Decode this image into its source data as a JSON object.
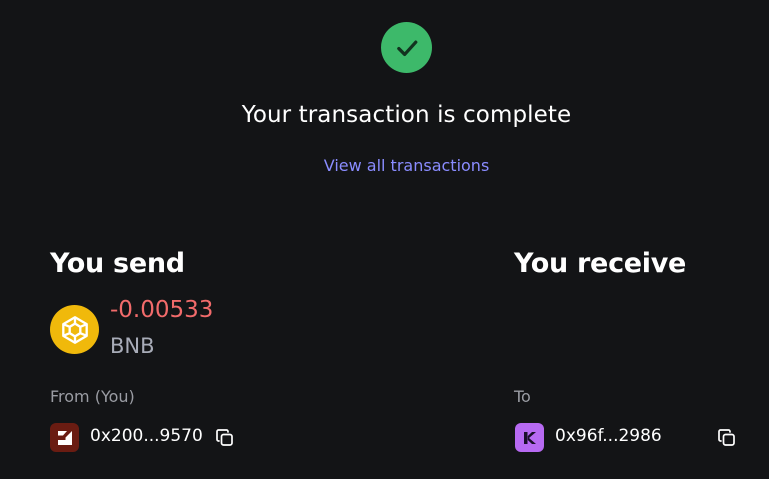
{
  "status": {
    "icon": "check-circle-icon",
    "title": "Your transaction is complete",
    "view_all_label": "View all transactions",
    "success_color": "#3db96a",
    "link_color": "#8a8cff"
  },
  "send": {
    "heading": "You send",
    "token_icon": "bnb-logo-icon",
    "amount": "-0.00533",
    "amount_color": "#f26b6b",
    "symbol": "BNB",
    "from_label": "From (You)",
    "wallet_icon": "wallet-avatar-icon",
    "address": "0x200...9570",
    "copy_icon": "copy-icon"
  },
  "receive": {
    "heading": "You receive",
    "to_label": "To",
    "wallet_icon": "contract-avatar-icon",
    "address": "0x96f...2986",
    "copy_icon": "copy-icon"
  }
}
